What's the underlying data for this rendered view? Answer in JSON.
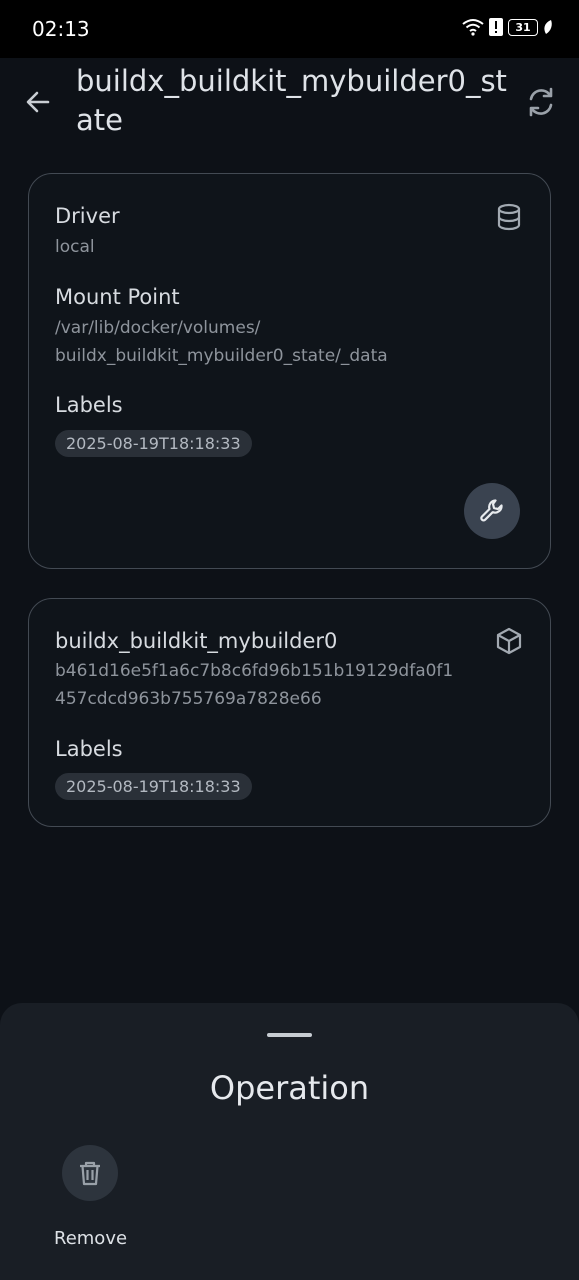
{
  "status_bar": {
    "time": "02:13",
    "battery": "31"
  },
  "app_bar": {
    "title": "buildx_buildkit_mybuilder0_state"
  },
  "volume_card": {
    "driver_label": "Driver",
    "driver_value": "local",
    "mount_label": "Mount Point",
    "mount_line1": "/var/lib/docker/volumes/",
    "mount_line2": "buildx_buildkit_mybuilder0_state/_data",
    "labels_label": "Labels",
    "label_chip": "2025-08-19T18:18:33"
  },
  "container_card": {
    "name": "buildx_buildkit_mybuilder0",
    "id_line1": "b461d16e5f1a6c7b8c6fd96b151b19129dfa0f1",
    "id_line2": "457cdcd963b755769a7828e66",
    "labels_label": "Labels",
    "label_chip": "2025-08-19T18:18:33"
  },
  "sheet": {
    "title": "Operation",
    "remove_label": "Remove"
  },
  "icons": {
    "back": "arrow-left-icon",
    "refresh": "refresh-icon",
    "database": "database-icon",
    "wrench": "wrench-icon",
    "cube": "cube-icon",
    "trash": "trash-icon"
  }
}
